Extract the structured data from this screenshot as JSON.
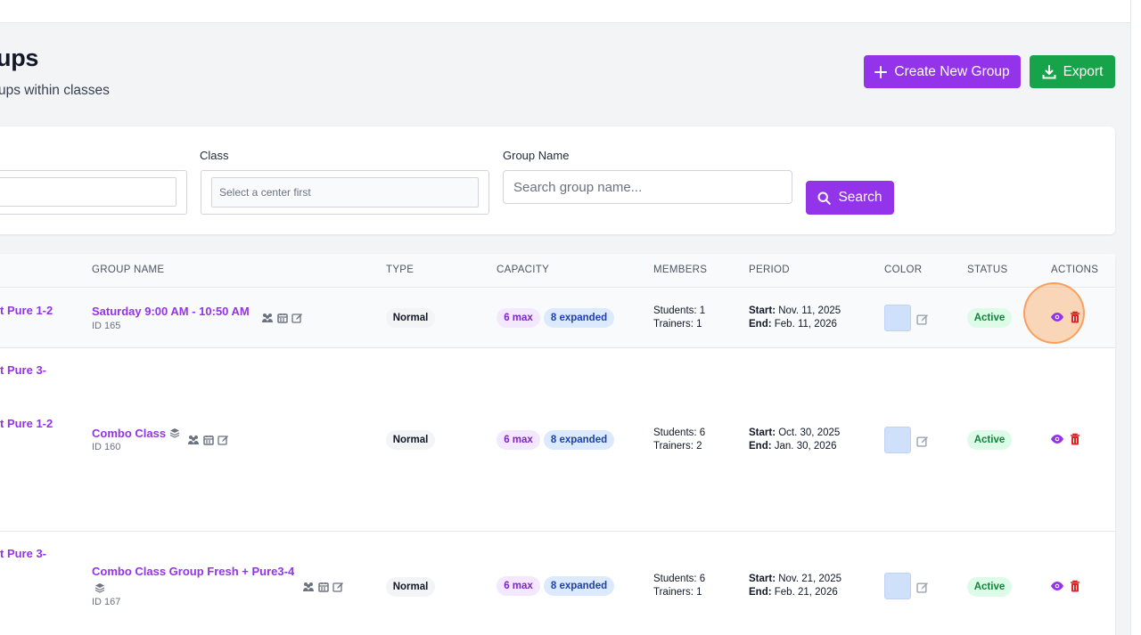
{
  "header": {
    "title": "ups",
    "subtitle": "ups within classes",
    "create_label": "Create New Group",
    "export_label": "Export"
  },
  "filters": {
    "class_label": "Class",
    "class_placeholder": "Select a center first",
    "group_name_label": "Group Name",
    "group_name_placeholder": "Search group name...",
    "search_label": "Search"
  },
  "table": {
    "columns": [
      "GROUP NAME",
      "TYPE",
      "CAPACITY",
      "MEMBERS",
      "PERIOD",
      "COLOR",
      "STATUS",
      "ACTIONS"
    ],
    "class_cells": [
      "t Pure 1-2",
      "t Pure 3-",
      "t Pure 1-2",
      "t Pure 3-"
    ],
    "rows": [
      {
        "group_name": "Saturday 9:00 AM - 10:50 AM",
        "id": "ID 165",
        "type": "Normal",
        "max": "6 max",
        "expanded": "8 expanded",
        "students": "Students: 1",
        "trainers": "Trainers: 1",
        "start_label": "Start:",
        "start": "Nov. 11, 2025",
        "end_label": "End:",
        "end": "Feb. 11, 2026",
        "status": "Active"
      },
      {
        "group_name": "Combo Class",
        "id": "ID 160",
        "type": "Normal",
        "max": "6 max",
        "expanded": "8 expanded",
        "students": "Students: 6",
        "trainers": "Trainers: 2",
        "start_label": "Start:",
        "start": "Oct. 30, 2025",
        "end_label": "End:",
        "end": "Jan. 30, 2026",
        "status": "Active"
      },
      {
        "group_name": "Combo Class Group Fresh + Pure3-4",
        "id": "ID 167",
        "type": "Normal",
        "max": "6 max",
        "expanded": "8 expanded",
        "students": "Students: 6",
        "trainers": "Trainers: 1",
        "start_label": "Start:",
        "start": "Nov. 21, 2025",
        "end_label": "End:",
        "end": "Feb. 21, 2026",
        "status": "Active"
      }
    ]
  },
  "colors": {
    "accent": "#9333ea",
    "export": "#16a34a",
    "swatch": "#cfe0fb",
    "danger": "#dc2626",
    "highlight": "#fb923c"
  }
}
